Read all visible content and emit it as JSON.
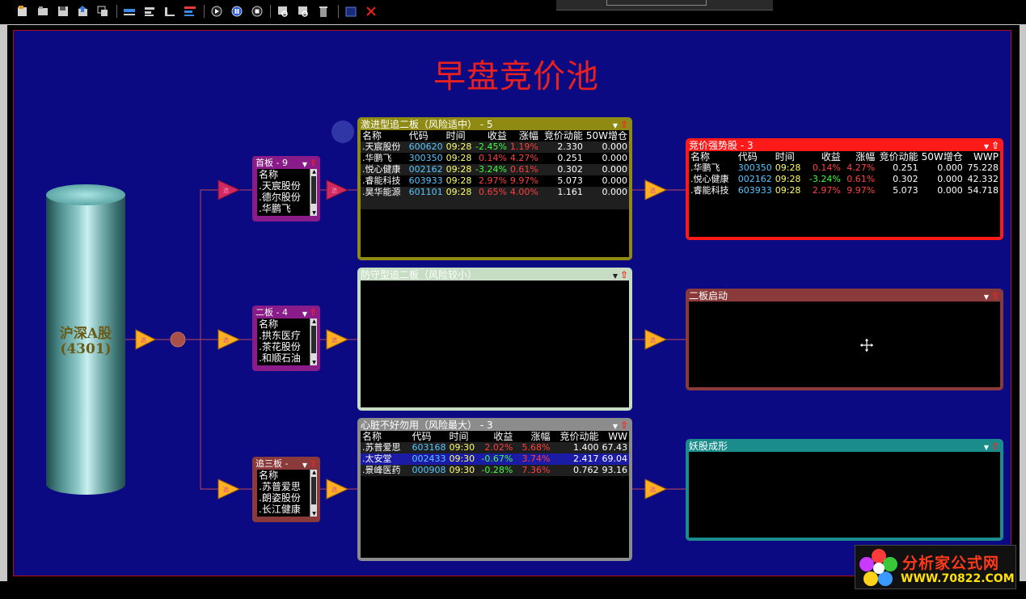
{
  "title": "早盘竞价池",
  "source": {
    "label": "沪深A股",
    "count": "(4301)"
  },
  "boards": {
    "first": {
      "title": "首板 - 9",
      "header": "名称",
      "items": [
        ".天宸股份",
        ".德尔股份",
        ".华鹏飞"
      ]
    },
    "second": {
      "title": "二板 - 4",
      "header": "名称",
      "items": [
        ".拱东医疗",
        ".茶花股份",
        ".和顺石油"
      ]
    },
    "third": {
      "title": "追三板 -",
      "header": "名称",
      "items": [
        ".苏普爱思",
        ".朗姿股份",
        ".长江健康"
      ]
    }
  },
  "aggressive": {
    "title": "激进型追二板（风险适中） - 5",
    "columns": [
      "名称",
      "代码",
      "时间",
      "收益",
      "涨幅",
      "竞价动能",
      "50W增仓"
    ],
    "rows": [
      {
        "name": ".天宸股份",
        "code": "600620",
        "time": "09:28",
        "ret": "-2.45%",
        "chg": "1.19%",
        "mom": "2.330",
        "inc": "0.000"
      },
      {
        "name": ".华鹏飞",
        "code": "300350",
        "time": "09:28",
        "ret": "0.14%",
        "chg": "4.27%",
        "mom": "0.251",
        "inc": "0.000"
      },
      {
        "name": ".悦心健康",
        "code": "002162",
        "time": "09:28",
        "ret": "-3.24%",
        "chg": "0.61%",
        "mom": "0.302",
        "inc": "0.000"
      },
      {
        "name": ".睿能科技",
        "code": "603933",
        "time": "09:28",
        "ret": "2.97%",
        "chg": "9.97%",
        "mom": "5.073",
        "inc": "0.000"
      },
      {
        "name": ".昊华能源",
        "code": "601101",
        "time": "09:28",
        "ret": "0.65%",
        "chg": "4.00%",
        "mom": "1.161",
        "inc": "0.000"
      }
    ]
  },
  "defensive": {
    "title": "防守型追二板（风险较小）"
  },
  "heart": {
    "title": "心脏不好勿用（风险最大） - 3",
    "columns": [
      "名称",
      "代码",
      "时间",
      "收益",
      "涨幅",
      "竞价动能",
      "WW"
    ],
    "rows": [
      {
        "name": ".苏普爱思",
        "code": "603168",
        "time": "09:30",
        "ret": "2.02%",
        "chg": "5.68%",
        "mom": "1.400",
        "ww": "67.43"
      },
      {
        "name": ".太安堂",
        "code": "002433",
        "time": "09:30",
        "ret": "-0.67%",
        "chg": "3.74%",
        "mom": "2.417",
        "ww": "69.04"
      },
      {
        "name": ".景峰医药",
        "code": "000908",
        "time": "09:30",
        "ret": "-0.28%",
        "chg": "7.36%",
        "mom": "0.762",
        "ww": "93.16"
      }
    ]
  },
  "strong": {
    "title": "竞价强势股 - 3",
    "columns": [
      "名称",
      "代码",
      "时间",
      "收益",
      "涨幅",
      "竞价动能",
      "50W增仓",
      "WWP"
    ],
    "rows": [
      {
        "name": ".华鹏飞",
        "code": "300350",
        "time": "09:28",
        "ret": "0.14%",
        "chg": "4.27%",
        "mom": "0.251",
        "inc": "0.000",
        "wwp": "75.228"
      },
      {
        "name": ".悦心健康",
        "code": "002162",
        "time": "09:28",
        "ret": "-3.24%",
        "chg": "0.61%",
        "mom": "0.302",
        "inc": "0.000",
        "wwp": "42.332"
      },
      {
        "name": ".睿能科技",
        "code": "603933",
        "time": "09:28",
        "ret": "2.97%",
        "chg": "9.97%",
        "mom": "5.073",
        "inc": "0.000",
        "wwp": "54.718"
      }
    ]
  },
  "second_start": {
    "title": "二板启动"
  },
  "demon": {
    "title": "妖股成形"
  },
  "logo": {
    "name": "分析家公式网",
    "url": "WWW.70822.COM"
  },
  "watermark": "......com",
  "colors": {
    "stage": "#0b0a82",
    "title": "#e8201e",
    "aggressive": "#8f8a14",
    "defensive": "#c6dcc3",
    "heart": "#8c8c8c",
    "strong": "#ff1a1a",
    "second_start": "#8a3a3a",
    "demon": "#1a8c8c",
    "board_first": "#8a1c8a",
    "board_second": "#8a1c8a",
    "board_third": "#8a3a3a"
  },
  "icons": [
    "new-icon",
    "open-icon",
    "save-icon",
    "export-icon",
    "window-icon",
    "align-top-icon",
    "align-left-icon",
    "align-bottom-icon",
    "align-center-icon",
    "play-icon",
    "pause-icon",
    "stop-icon",
    "zoom-in-icon",
    "zoom-out-icon",
    "trash-icon",
    "frame-icon",
    "close-icon"
  ]
}
